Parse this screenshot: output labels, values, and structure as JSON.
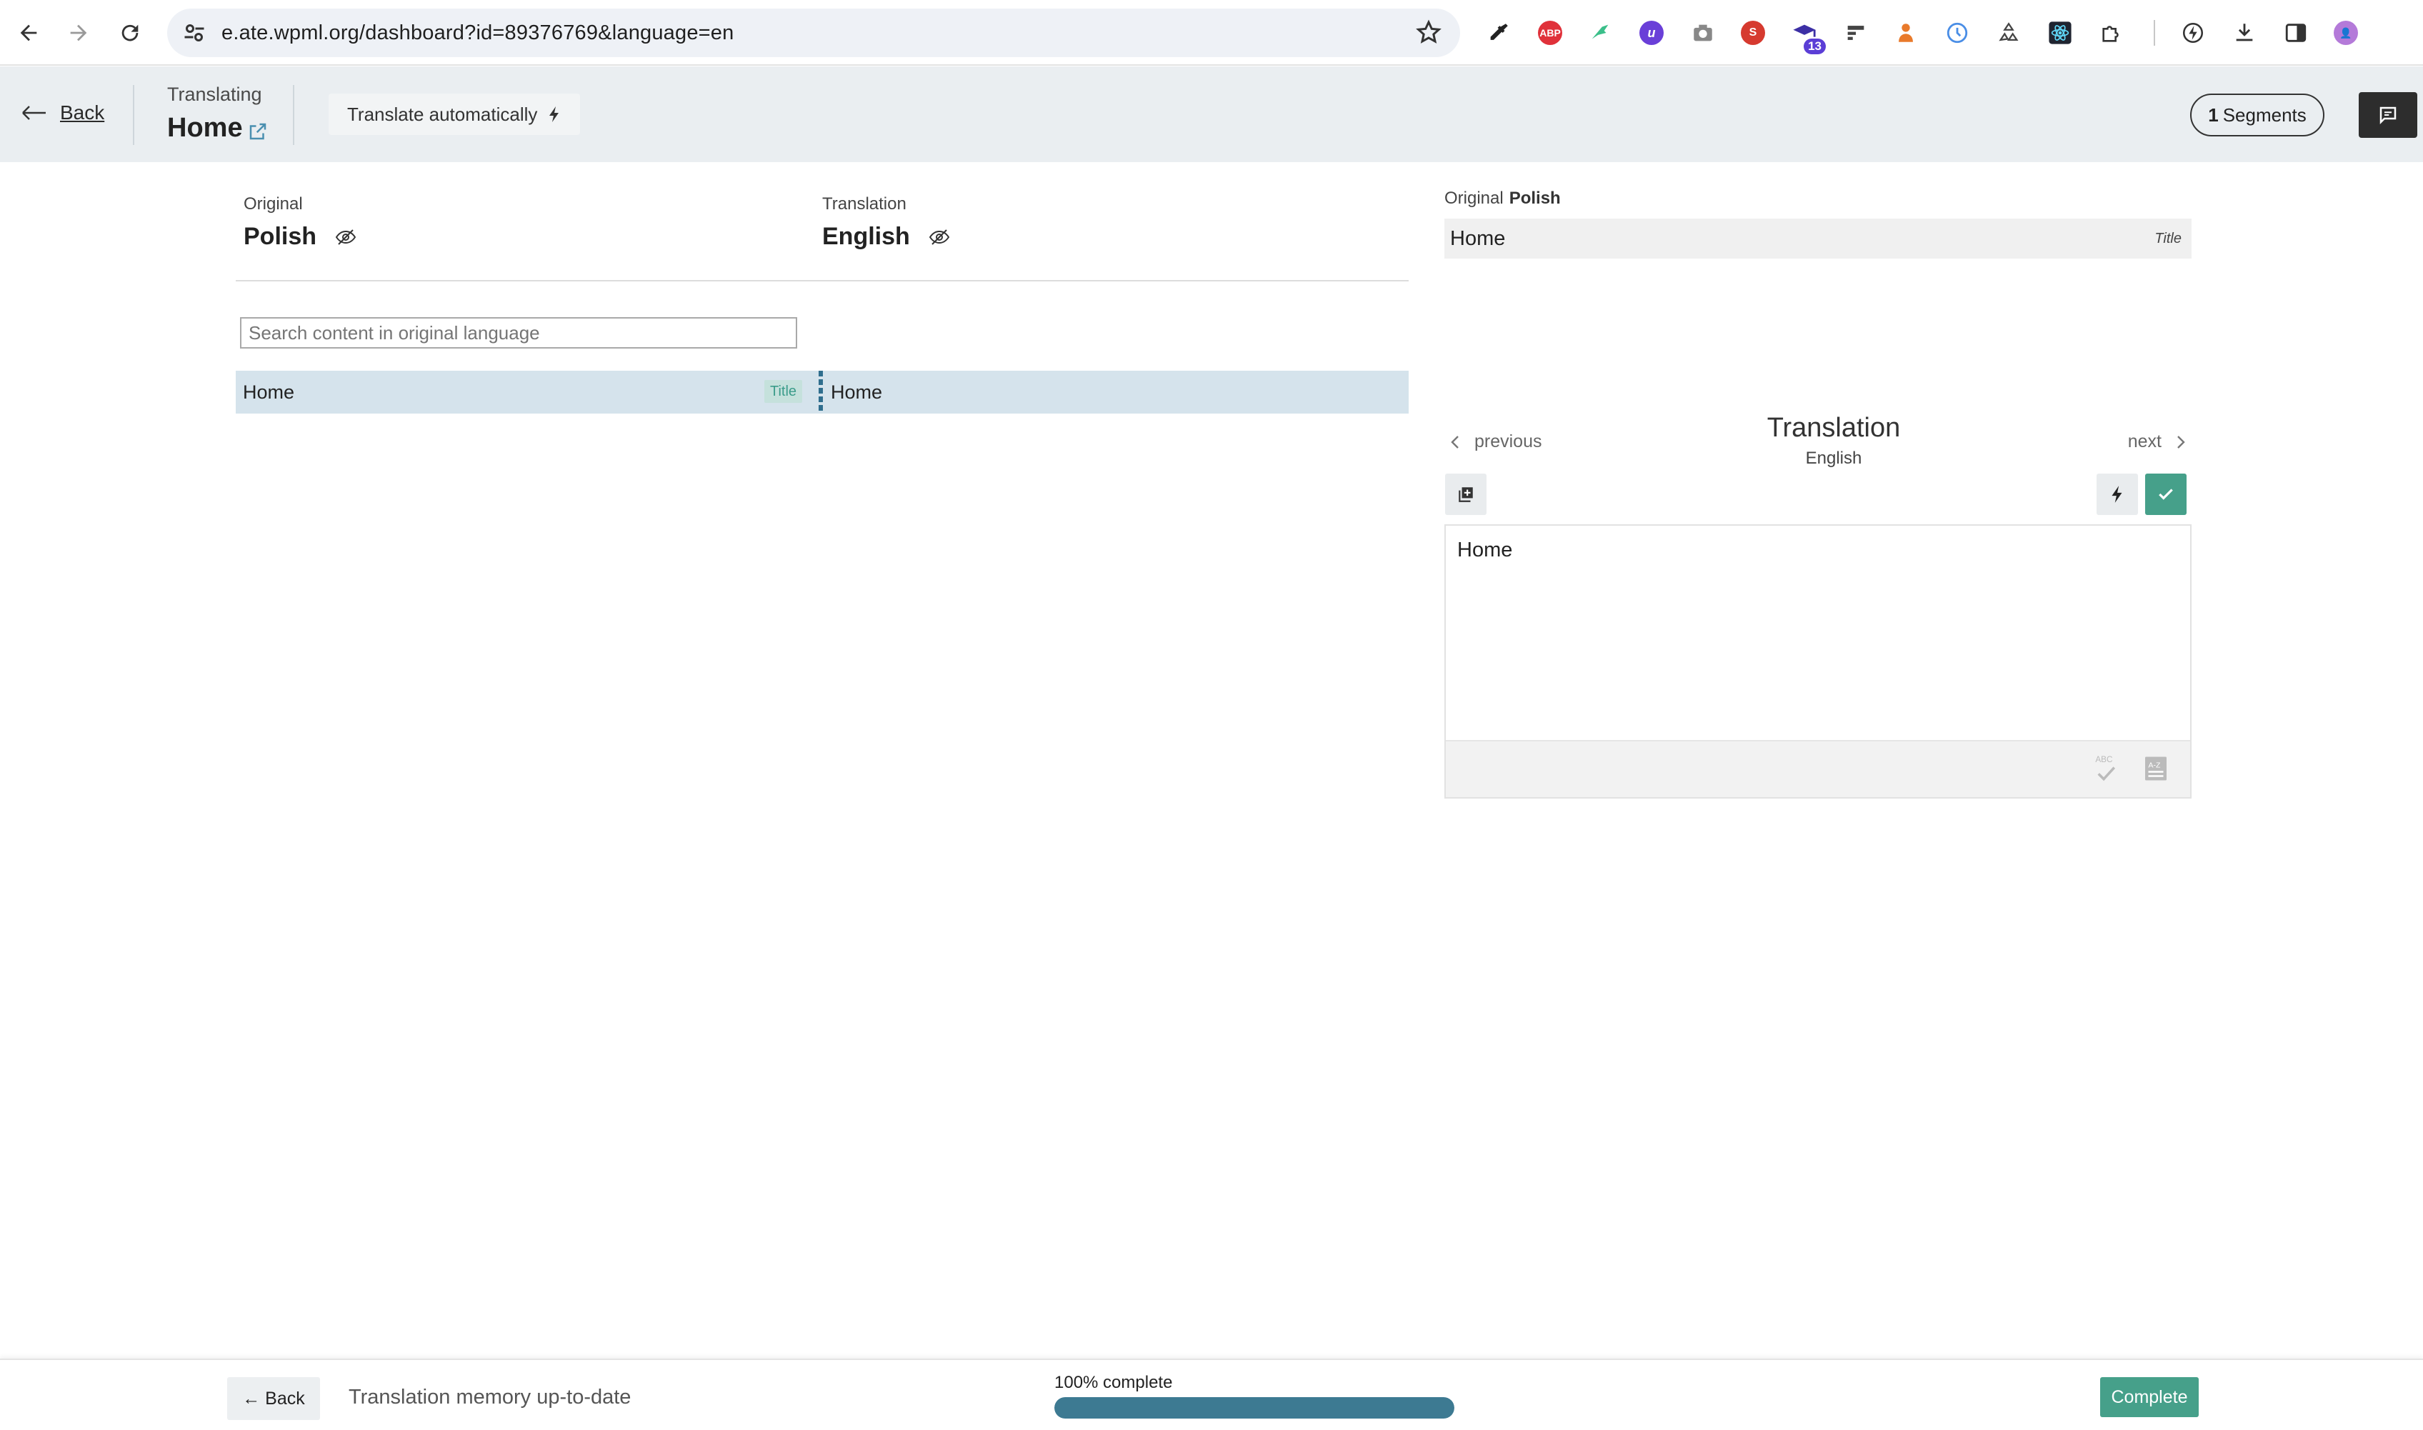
{
  "browser": {
    "url": "e.ate.wpml.org/dashboard?id=89376769&language=en",
    "extensions": [
      "eyedropper-icon",
      "adblock-icon",
      "hummingbird-icon",
      "u-extension-icon",
      "camera-icon",
      "seo-icon",
      "graduation-cap-icon",
      "reader-icon",
      "person-icon",
      "clock-icon",
      "recycle-icon",
      "react-icon",
      "puzzle-icon",
      "performance-icon",
      "download-icon",
      "sidebar-icon",
      "profile-avatar"
    ],
    "badge_count": "13"
  },
  "header": {
    "back_label": "Back",
    "translating_label": "Translating",
    "page_title": "Home",
    "translate_auto_label": "Translate automatically",
    "segments_count": "1",
    "segments_label": "Segments"
  },
  "editor": {
    "original_label": "Original",
    "original_language": "Polish",
    "translation_label": "Translation",
    "translation_language": "English",
    "search_placeholder": "Search content in original language",
    "segments": [
      {
        "source": "Home",
        "tag": "Title",
        "target": "Home"
      }
    ]
  },
  "side_panel": {
    "original_label": "Original",
    "original_language": "Polish",
    "original_text": "Home",
    "original_tag": "Title",
    "prev_label": "previous",
    "next_label": "next",
    "title": "Translation",
    "language": "English",
    "translation_text": "Home"
  },
  "footer": {
    "back_label": "← Back",
    "status": "Translation memory up-to-date",
    "progress_label": "100% complete",
    "progress_fraction": 1.0,
    "complete_label": "Complete"
  },
  "colors": {
    "accent_teal": "#46a08a",
    "progress_blue": "#3d7a92",
    "segment_highlight": "#d5e3ec",
    "header_bg": "#eaeef1"
  }
}
